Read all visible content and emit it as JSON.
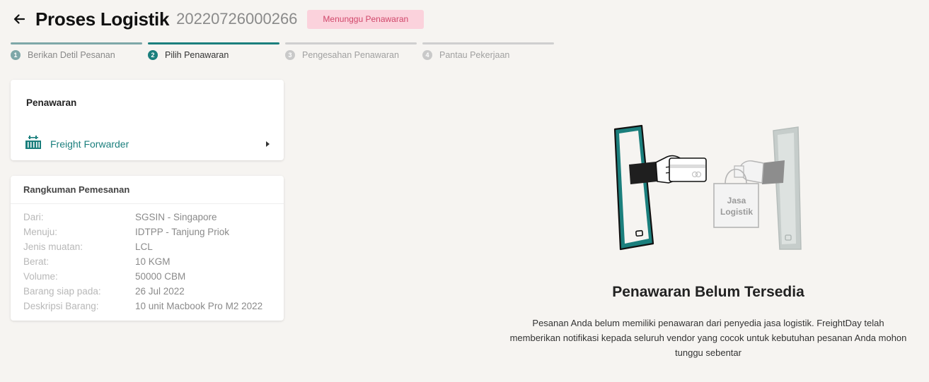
{
  "header": {
    "title": "Proses Logistik",
    "order_id": "20220726000266",
    "status": "Menunggu Penawaran"
  },
  "steps": [
    {
      "num": "1",
      "label": "Berikan Detil Pesanan",
      "state": "done"
    },
    {
      "num": "2",
      "label": "Pilih Penawaran",
      "state": "active"
    },
    {
      "num": "3",
      "label": "Pengesahan Penawaran",
      "state": "pending"
    },
    {
      "num": "4",
      "label": "Pantau Pekerjaan",
      "state": "pending"
    }
  ],
  "offer": {
    "title": "Penawaran",
    "item_label": "Freight Forwarder",
    "item_icon": "container-icon"
  },
  "summary": {
    "title": "Rangkuman Pemesanan",
    "rows": [
      {
        "label": "Dari:",
        "value": "SGSIN - Singapore"
      },
      {
        "label": "Menuju:",
        "value": "IDTPP - Tanjung Priok"
      },
      {
        "label": "Jenis muatan:",
        "value": "LCL"
      },
      {
        "label": "Berat:",
        "value": "10 KGM"
      },
      {
        "label": "Volume:",
        "value": "50000 CBM"
      },
      {
        "label": "Barang siap pada:",
        "value": "26 Jul 2022"
      },
      {
        "label": "Deskripsi Barang:",
        "value": "10 unit Macbook Pro M2 2022"
      }
    ]
  },
  "empty_state": {
    "bag_text": "Jasa Logistik",
    "title": "Penawaran Belum Tersedia",
    "description": "Pesanan Anda belum memiliki penawaran dari penyedia jasa logistik. FreightDay telah memberikan notifikasi kepada seluruh vendor yang cocok untuk kebutuhan pesanan Anda mohon tunggu sebentar"
  },
  "colors": {
    "accent": "#1b7f7d",
    "badge_bg": "#fbd2dc",
    "badge_text": "#d0476a",
    "background": "#f6f4f1"
  }
}
